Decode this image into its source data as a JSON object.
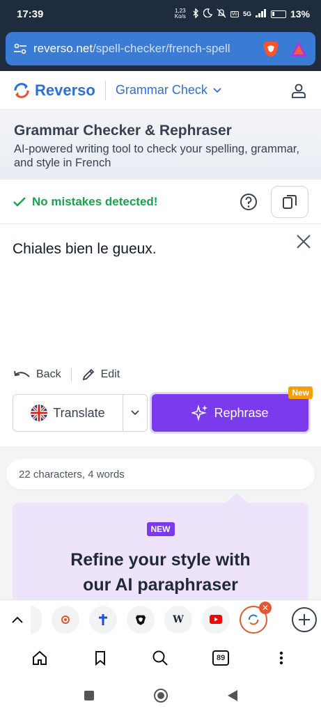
{
  "status_bar": {
    "time": "17:39",
    "net_speed": "1,23 Ko/s",
    "network": "5G",
    "battery": "13%"
  },
  "browser": {
    "url_host": "reverso.net",
    "url_path": "/spell-checker/french-spell"
  },
  "header": {
    "brand": "Reverso",
    "product": "Grammar Check"
  },
  "intro": {
    "title": "Grammar Checker & Rephraser",
    "subtitle": "AI-powered writing tool to check your spelling, grammar, and style in French"
  },
  "editor": {
    "status": "No mistakes detected!",
    "text": "Chiales bien le gueux.",
    "back_label": "Back",
    "edit_label": "Edit",
    "translate_label": "Translate",
    "rephrase_label": "Rephrase",
    "new_badge": "New"
  },
  "stats": {
    "characters": "22 characters,",
    "words": "4 words"
  },
  "promo": {
    "badge": "NEW",
    "line1": "Refine your style with",
    "line2": "our AI paraphraser"
  },
  "tabs": {
    "count": "89",
    "wiki_label": "W"
  },
  "colors": {
    "accent": "#7c3aed",
    "brand": "#2a6fdb",
    "success": "#16a34a",
    "badge": "#f59e0b"
  }
}
